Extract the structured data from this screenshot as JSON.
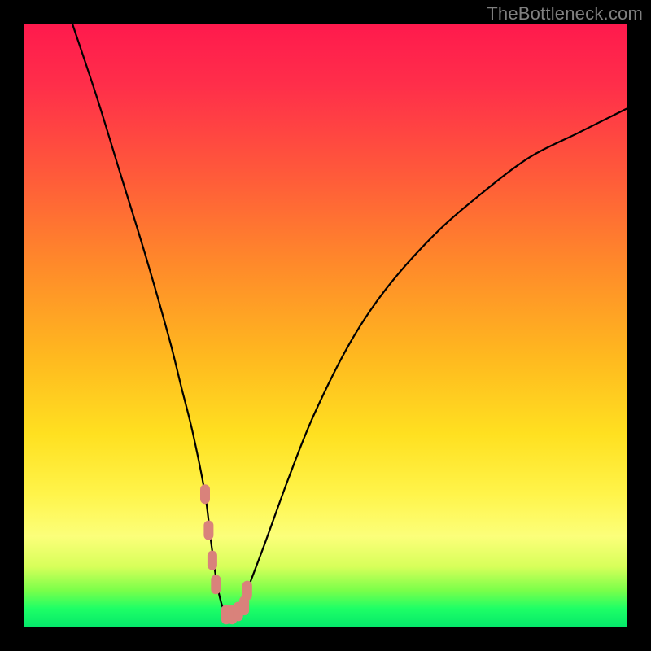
{
  "watermark": "TheBottleneck.com",
  "chart_data": {
    "type": "line",
    "title": "",
    "xlabel": "",
    "ylabel": "",
    "xlim": [
      0,
      100
    ],
    "ylim": [
      0,
      100
    ],
    "grid": false,
    "legend": false,
    "series": [
      {
        "name": "bottleneck-curve",
        "color": "#000000",
        "x": [
          8,
          12,
          16,
          20,
          24,
          26,
          28,
          30,
          31,
          32,
          33,
          34,
          35,
          36,
          37,
          40,
          44,
          48,
          54,
          60,
          68,
          76,
          84,
          92,
          100
        ],
        "y": [
          100,
          88,
          75,
          62,
          48,
          40,
          32,
          22,
          14,
          7,
          3,
          2,
          2,
          3,
          6,
          14,
          25,
          35,
          47,
          56,
          65,
          72,
          78,
          82,
          86
        ]
      }
    ],
    "highlight_points": {
      "name": "highlight",
      "color": "#d9827b",
      "x": [
        30.0,
        30.6,
        31.2,
        31.8,
        33.5,
        34.5,
        35.5,
        36.5,
        37.0
      ],
      "y": [
        22,
        16,
        11,
        7,
        2,
        2,
        2.5,
        3.5,
        6
      ]
    }
  }
}
